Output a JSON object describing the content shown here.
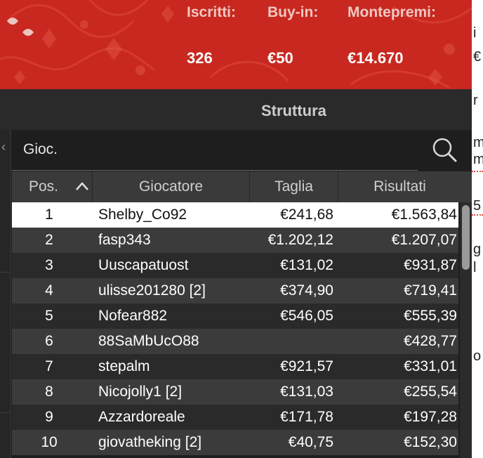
{
  "banner": {
    "stats": [
      {
        "label": "Iscritti:",
        "value": "326"
      },
      {
        "label": "Buy-in:",
        "value": "€50"
      },
      {
        "label": "Montepremi:",
        "value": "€14.670"
      }
    ]
  },
  "tabs": {
    "active": "Struttura"
  },
  "search": {
    "placeholder": "Gioc."
  },
  "table": {
    "columns": [
      "Pos.",
      "Giocatore",
      "Taglia",
      "Risultati"
    ],
    "sort": {
      "column": "Pos.",
      "direction": "asc"
    },
    "rows": [
      {
        "pos": "1",
        "player": "Shelby_Co92",
        "size": "€241,68",
        "result": "€1.563,84"
      },
      {
        "pos": "2",
        "player": "fasp343",
        "size": "€1.202,12",
        "result": "€1.207,07"
      },
      {
        "pos": "3",
        "player": "Uuscapatuost",
        "size": "€131,02",
        "result": "€931,87"
      },
      {
        "pos": "4",
        "player": "ulisse201280 [2]",
        "size": "€374,90",
        "result": "€719,41"
      },
      {
        "pos": "5",
        "player": "Nofear882",
        "size": "€546,05",
        "result": "€555,39"
      },
      {
        "pos": "6",
        "player": "88SaMbUcO88",
        "size": "",
        "result": "€428,77"
      },
      {
        "pos": "7",
        "player": "stepalm",
        "size": "€921,57",
        "result": "€331,01"
      },
      {
        "pos": "8",
        "player": "Nicojolly1 [2]",
        "size": "€131,03",
        "result": "€255,54"
      },
      {
        "pos": "9",
        "player": "Azzardoreale",
        "size": "€171,78",
        "result": "€197,28"
      },
      {
        "pos": "10",
        "player": "giovatheking [2]",
        "size": "€40,75",
        "result": "€152,30"
      }
    ]
  },
  "page_fragments": [
    "i",
    "€",
    "r",
    "m",
    "m",
    "5",
    "g",
    "l",
    "o"
  ],
  "colors": {
    "banner_red": "#c8281f",
    "panel_bg": "#1e1e1e",
    "row_even": "#2a2a2a",
    "row_odd": "#3b3b3b",
    "selected_row": "#ffffff"
  }
}
